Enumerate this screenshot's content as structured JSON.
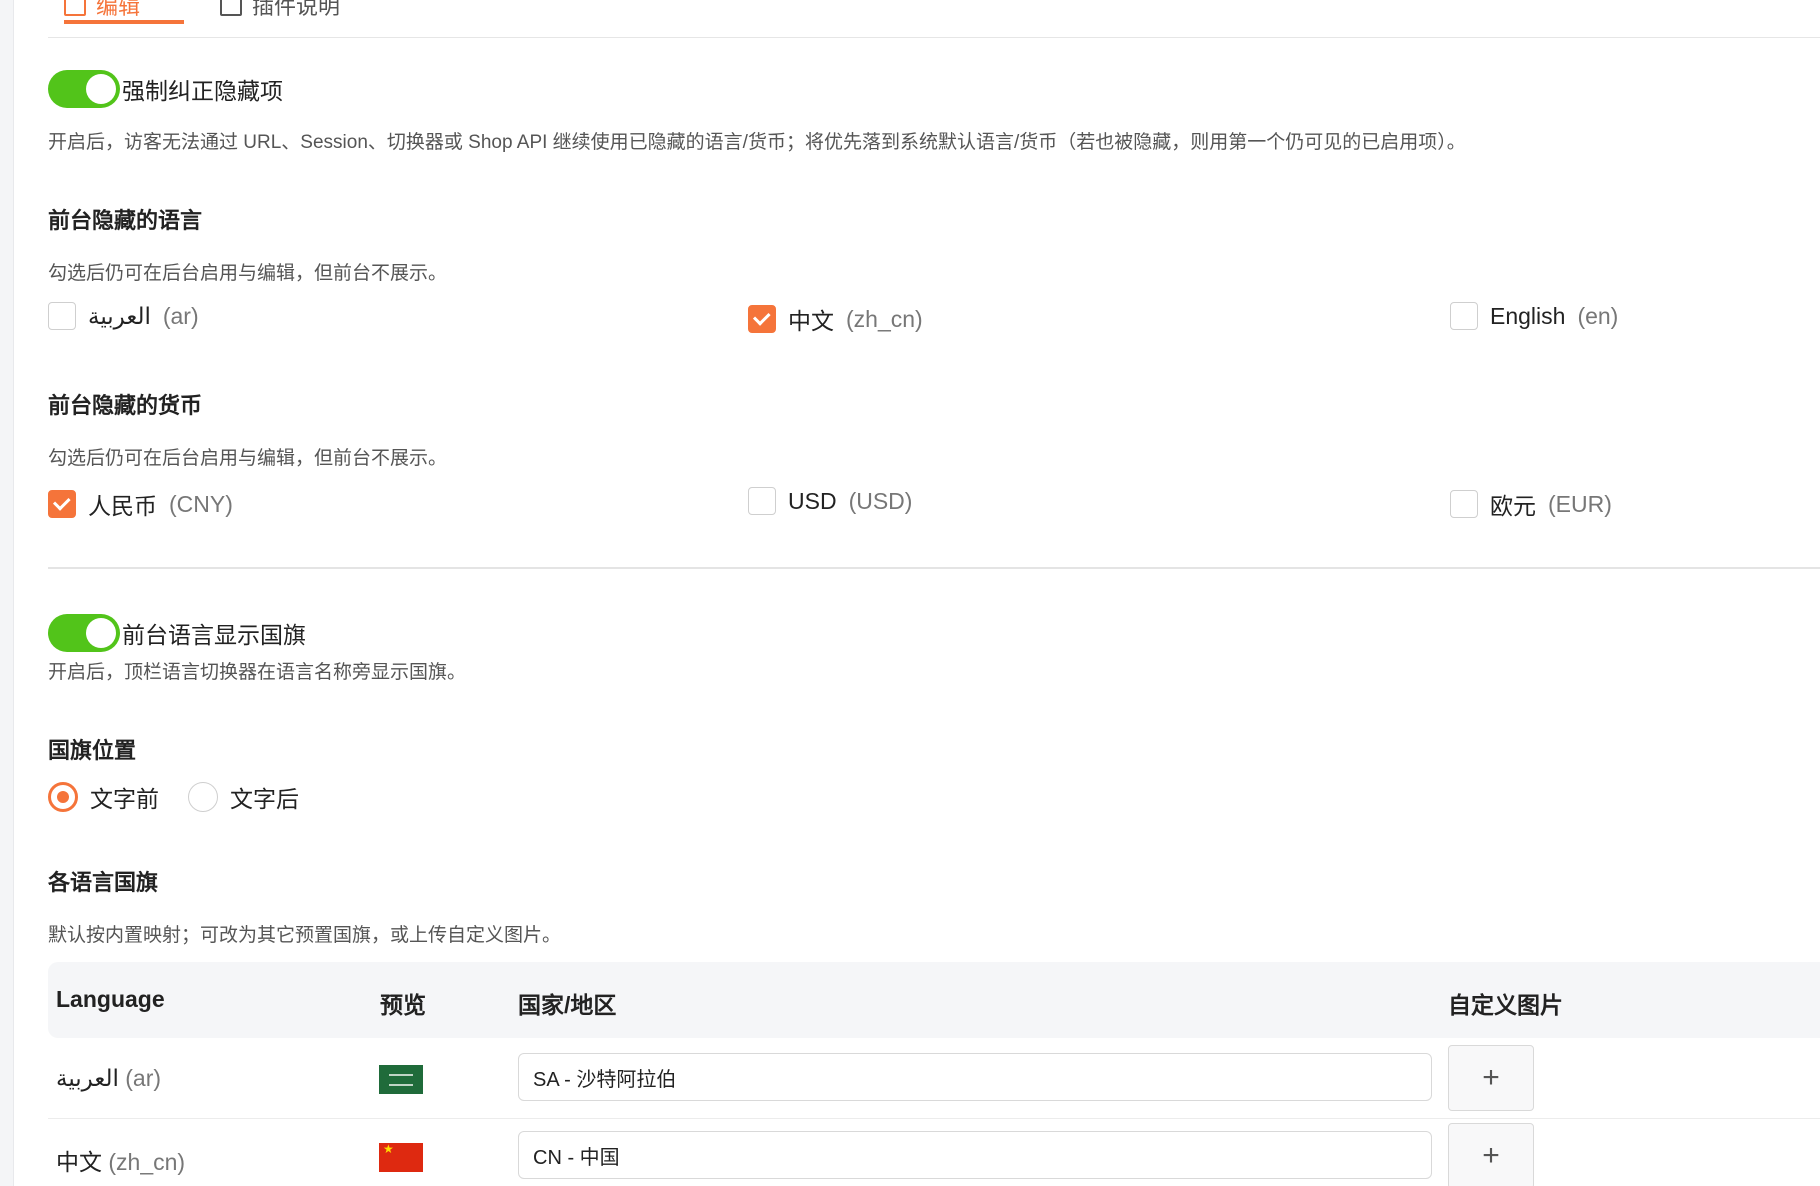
{
  "tabs": [
    {
      "label": "编辑",
      "active": true
    },
    {
      "label": "插件说明",
      "active": false
    }
  ],
  "force_hide": {
    "toggle_label": "强制纠正隐藏项",
    "enabled": true,
    "description": "开启后，访客无法通过 URL、Session、切换器或 Shop API 继续使用已隐藏的语言/货币；将优先落到系统默认语言/货币（若也被隐藏，则用第一个仍可见的已启用项）。"
  },
  "hidden_languages": {
    "title": "前台隐藏的语言",
    "hint": "勾选后仍可在后台启用与编辑，但前台不展示。",
    "options": [
      {
        "name": "العربية",
        "code": "(ar)",
        "checked": false
      },
      {
        "name": "中文",
        "code": "(zh_cn)",
        "checked": true
      },
      {
        "name": "English",
        "code": "(en)",
        "checked": false
      }
    ]
  },
  "hidden_currencies": {
    "title": "前台隐藏的货币",
    "hint": "勾选后仍可在后台启用与编辑，但前台不展示。",
    "options": [
      {
        "name": "人民币",
        "code": "(CNY)",
        "checked": true
      },
      {
        "name": "USD",
        "code": "(USD)",
        "checked": false
      },
      {
        "name": "欧元",
        "code": "(EUR)",
        "checked": false
      }
    ]
  },
  "show_flags": {
    "toggle_label": "前台语言显示国旗",
    "enabled": true,
    "description": "开启后，顶栏语言切换器在语言名称旁显示国旗。"
  },
  "flag_position": {
    "title": "国旗位置",
    "options": [
      {
        "label": "文字前",
        "selected": true
      },
      {
        "label": "文字后",
        "selected": false
      }
    ]
  },
  "language_flags": {
    "title": "各语言国旗",
    "hint": "默认按内置映射；可改为其它预置国旗，或上传自定义图片。",
    "headers": {
      "language": "Language",
      "preview": "预览",
      "country": "国家/地区",
      "custom_image": "自定义图片"
    },
    "rows": [
      {
        "name": "العربية",
        "code": "(ar)",
        "flag": "saudi-arabia-flag",
        "country": "SA - 沙特阿拉伯",
        "upload": "+"
      },
      {
        "name": "中文",
        "code": "(zh_cn)",
        "flag": "china-flag",
        "country": "CN - 中国",
        "upload": "+"
      }
    ]
  },
  "colors": {
    "accent": "#f5743a",
    "toggle_on": "#52c41a"
  }
}
